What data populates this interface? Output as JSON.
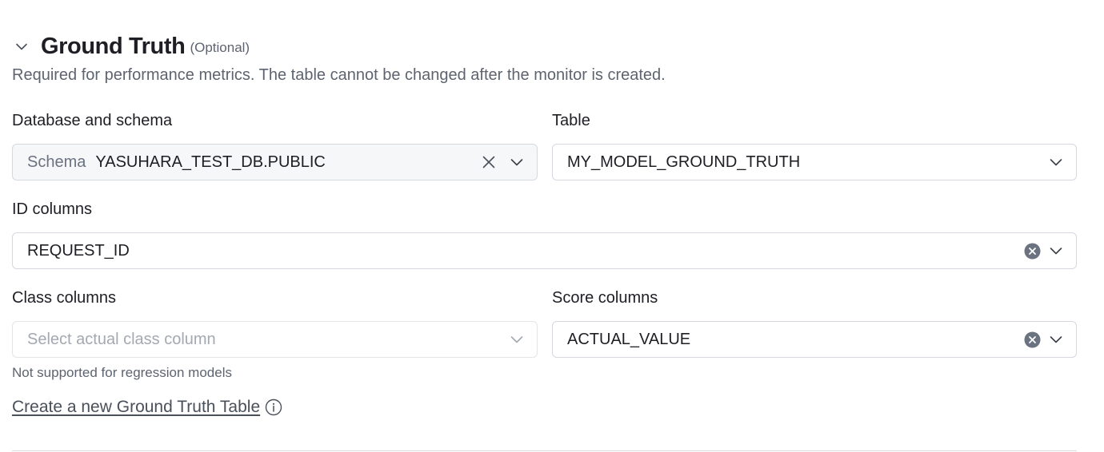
{
  "section": {
    "title": "Ground Truth",
    "optional_tag": "(Optional)",
    "description": "Required for performance metrics. The table cannot be changed after the monitor is created."
  },
  "database_schema": {
    "label": "Database and schema",
    "prefix": "Schema",
    "value": "YASUHARA_TEST_DB.PUBLIC"
  },
  "table": {
    "label": "Table",
    "value": "MY_MODEL_GROUND_TRUTH"
  },
  "id_columns": {
    "label": "ID columns",
    "value": "REQUEST_ID"
  },
  "class_columns": {
    "label": "Class columns",
    "placeholder": "Select actual class column",
    "help": "Not supported for regression models"
  },
  "score_columns": {
    "label": "Score columns",
    "value": "ACTUAL_VALUE"
  },
  "create_link": {
    "label": "Create a new Ground Truth Table"
  },
  "icons": {
    "collapse": "chevron-down-icon",
    "clear": "close-icon",
    "clear_filled": "close-circle-icon",
    "dropdown": "chevron-down-icon",
    "info": "info-icon"
  },
  "colors": {
    "text": "#1e1e24",
    "muted": "#5d6470",
    "border": "#d5d8de",
    "clear_circle": "#6b7280"
  }
}
